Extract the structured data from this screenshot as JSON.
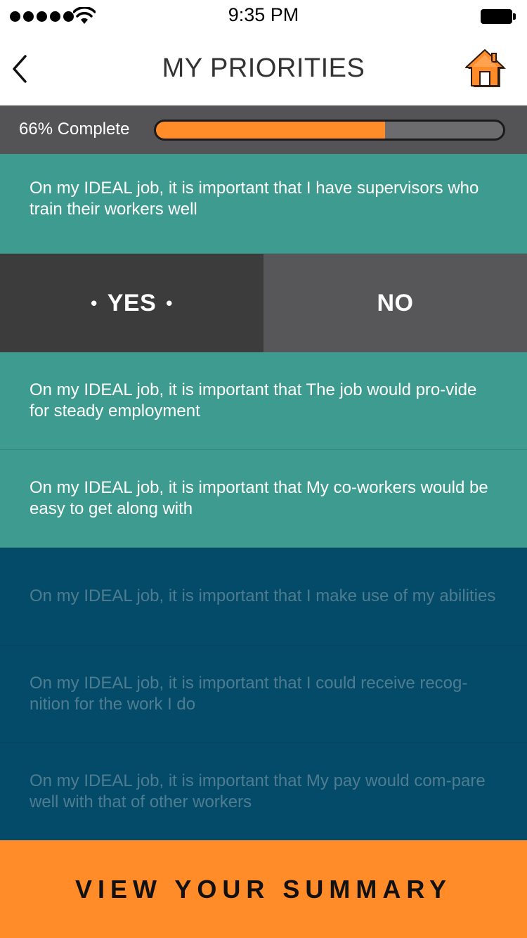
{
  "status_bar": {
    "time": "9:35 PM",
    "signal_icon": "signal-dots-icon",
    "wifi_icon": "wifi-icon",
    "battery_icon": "battery-icon"
  },
  "nav": {
    "title": "MY PRIORITIES",
    "back_icon": "chevron-left-icon",
    "home_icon": "home-icon"
  },
  "progress": {
    "label": "66% Complete",
    "value": 0.66,
    "fill_color": "#ff8c28"
  },
  "items": [
    {
      "text": "On my IDEAL job, it is important that I have supervisors who train their workers well",
      "state": "answering"
    },
    {
      "text": "On my IDEAL job, it is important that The job would pro-vide for steady employment",
      "state": "active"
    },
    {
      "text": "On my IDEAL job, it is important that My co-workers would be easy to get along with",
      "state": "active"
    },
    {
      "text": "On my IDEAL job, it is important that I make use of my abilities",
      "state": "disabled"
    },
    {
      "text": "On my IDEAL job, it is important that I could receive recog-nition for the work I do",
      "state": "disabled"
    },
    {
      "text": "On my IDEAL job, it is important that My pay would com-pare well with that of other workers",
      "state": "disabled"
    }
  ],
  "answers": {
    "yes_label": "YES",
    "no_label": "NO",
    "selected_bullet": "•"
  },
  "colors": {
    "teal": "#3d9b8f",
    "navy": "#044b6a",
    "accent": "#ff8c28"
  },
  "footer": {
    "summary_label": "VIEW YOUR SUMMARY"
  }
}
